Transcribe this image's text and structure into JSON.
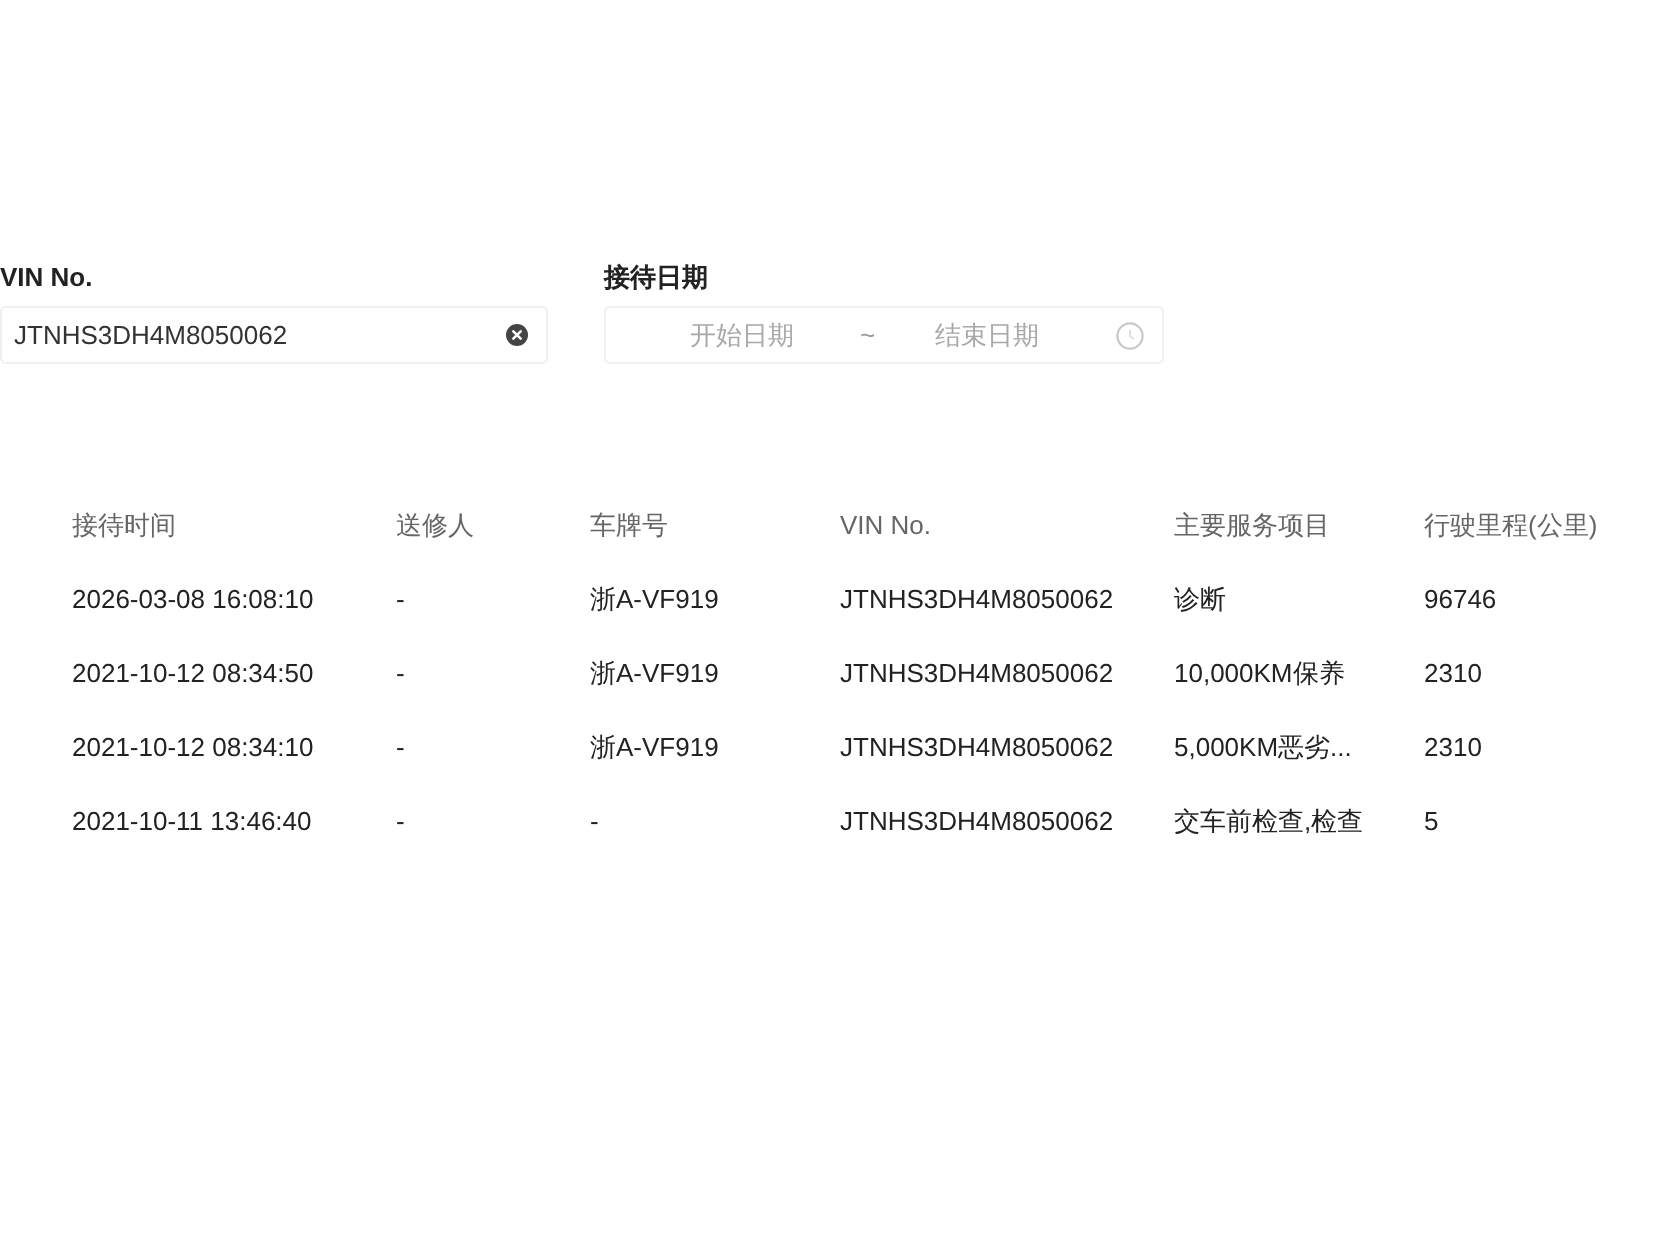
{
  "filters": [
    {
      "kind": "text",
      "label": "VIN No.",
      "value": "JTNHS3DH4M8050062"
    },
    {
      "kind": "date_range",
      "label": "接待日期",
      "start_placeholder": "开始日期",
      "separator": "~",
      "end_placeholder": "结束日期"
    }
  ],
  "table": {
    "columns": [
      "接待时间",
      "送修人",
      "车牌号",
      "VIN No.",
      "主要服务项目",
      "行驶里程(公里)"
    ],
    "rows": [
      [
        "2026-03-08 16:08:10",
        "-",
        "浙A-VF919",
        "JTNHS3DH4M8050062",
        "诊断",
        "96746"
      ],
      [
        "2021-10-12 08:34:50",
        "-",
        "浙A-VF919",
        "JTNHS3DH4M8050062",
        "10,000KM保养",
        "2310"
      ],
      [
        "2021-10-12 08:34:10",
        "-",
        "浙A-VF919",
        "JTNHS3DH4M8050062",
        "5,000KM恶劣...",
        "2310"
      ],
      [
        "2021-10-11 13:46:40",
        "-",
        "-",
        "JTNHS3DH4M8050062",
        "交车前检查,检查",
        "5"
      ]
    ]
  }
}
